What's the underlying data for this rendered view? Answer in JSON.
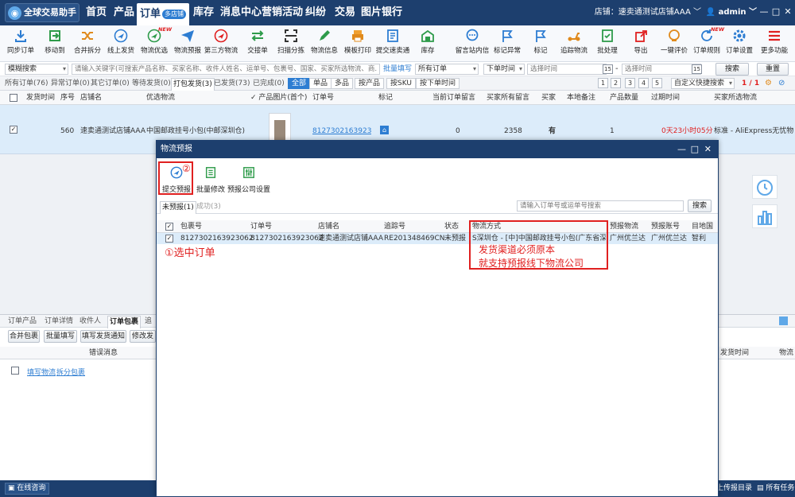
{
  "app": {
    "title": "全球交易助手"
  },
  "nav": [
    {
      "label": "首页"
    },
    {
      "label": "产品"
    },
    {
      "label": "订单",
      "badge": "多店铺"
    },
    {
      "label": "库存"
    },
    {
      "label": "消息中心"
    },
    {
      "label": "营销活动"
    },
    {
      "label": "纠纷"
    },
    {
      "label": "交易"
    },
    {
      "label": "图片银行"
    }
  ],
  "store": {
    "text": "店铺：速卖通测试店铺AAA"
  },
  "user": {
    "name": "admin"
  },
  "toolbar": [
    {
      "label": "同步订单",
      "icon": "download-icon"
    },
    {
      "label": "移动到",
      "icon": "move-icon"
    },
    {
      "label": "合并拆分",
      "icon": "shuffle-icon"
    },
    {
      "label": "线上发货",
      "icon": "plane-icon"
    },
    {
      "label": "物流优选",
      "icon": "plane-icon",
      "new": "NEW"
    },
    {
      "label": "物流预报",
      "icon": "paper-plane-icon"
    },
    {
      "label": "第三方物流",
      "icon": "third-party-icon"
    },
    {
      "label": "交接单",
      "icon": "exchange-icon"
    },
    {
      "label": "扫描分拣",
      "icon": "scan-icon"
    },
    {
      "label": "物流信息",
      "icon": "pencil-icon"
    },
    {
      "label": "模板打印",
      "icon": "printer-icon"
    },
    {
      "label": "提交速卖通",
      "icon": "document-icon"
    },
    {
      "label": "库存",
      "icon": "warehouse-icon"
    },
    {
      "label": "留言站内信",
      "icon": "message-icon"
    },
    {
      "label": "标记异常",
      "icon": "flag-icon"
    },
    {
      "label": "标记",
      "icon": "flag-icon"
    },
    {
      "label": "追踪物流",
      "icon": "scooter-icon"
    },
    {
      "label": "批处理",
      "icon": "checklist-icon"
    },
    {
      "label": "导出",
      "icon": "export-icon"
    },
    {
      "label": "一键评价",
      "icon": "review-icon"
    },
    {
      "label": "订单规则",
      "icon": "refresh-icon",
      "new": "NEW"
    },
    {
      "label": "订单设置",
      "icon": "gear-icon"
    },
    {
      "label": "更多功能",
      "icon": "menu-icon"
    }
  ],
  "filter": {
    "mode": "模糊搜索",
    "keyword_placeholder": "请输入关键字(可搜索产品名称、买家名称、收件人姓名、运单号、包裹号、国家、买家所选物流、商...",
    "batch_fill": "批量填写",
    "order_select": "所有订单",
    "time_type": "下单时间",
    "start_placeholder": "选择时间",
    "end_placeholder": "选择时间",
    "date_icon": "15",
    "search": "搜索",
    "reset": "重置"
  },
  "tabs": [
    {
      "label": "所有订单(76)"
    },
    {
      "label": "异常订单(0)"
    },
    {
      "label": "其它订单(0)"
    },
    {
      "label": "等待发货(0)"
    },
    {
      "label": "打包发货(3)"
    },
    {
      "label": "已发货(73)"
    },
    {
      "label": "已完成(0)"
    }
  ],
  "chips": [
    {
      "label": "全部"
    },
    {
      "label": "单品"
    },
    {
      "label": "多品"
    },
    {
      "label": "按产品"
    },
    {
      "label": "按SKU"
    },
    {
      "label": "按下单时间"
    }
  ],
  "pager": {
    "pages": [
      "1",
      "2",
      "3",
      "4",
      "5"
    ],
    "sort": "自定义快捷搜索",
    "count": "1 / 1"
  },
  "grid": {
    "headers": [
      "发货时间",
      "序号",
      "店铺名",
      "优选物流",
      "产品图片(首个)",
      "订单号",
      "标记",
      "当前订单留言",
      "买家所有留言",
      "买家",
      "本地备注",
      "产品数量",
      "过期时间",
      "买家所选物流"
    ],
    "row": {
      "seq": "560",
      "store": "速卖通测试店铺AAA",
      "logistics": "中国邮政挂号小包(中邮深圳仓)",
      "order": "8127302163923062",
      "cur_msg": "0",
      "all_msg": "2358",
      "buyer": "有",
      "qty": "1",
      "expire": "0天23小时05分",
      "buyer_logistics": "标准 - AliExpress无忧物流"
    }
  },
  "bottom": {
    "tabs": [
      "订单产品",
      "订单详情",
      "收件人",
      "订单包裹",
      "追"
    ],
    "buttons": [
      "合并包裹",
      "批量填写",
      "填写发货通知",
      "修改发货"
    ],
    "col_error": "错误消息",
    "col_ship": "发货时间",
    "col_log": "物流",
    "link_fill": "填写物流",
    "link_split": "拆分包裹"
  },
  "status": {
    "consult": "在线咨询",
    "report": "查看上传报目录",
    "tasks": "所有任务"
  },
  "dialog": {
    "title": "物流预报",
    "toolbar": [
      {
        "label": "提交预报",
        "icon": "paper-plane-icon"
      },
      {
        "label": "批量修改",
        "icon": "batch-edit-icon"
      },
      {
        "label": "预报公司设置",
        "icon": "settings-sliders-icon"
      }
    ],
    "marker2": "②",
    "tabs": [
      "未预报(1)",
      "成功(3)"
    ],
    "search_placeholder": "请输入订单号或运单号搜索",
    "search": "搜索",
    "headers": [
      "包裹号",
      "订单号",
      "店铺名",
      "追踪号",
      "状态",
      "物流方式",
      "预报物流",
      "预报账号",
      "目地国"
    ],
    "row": {
      "package": "8127302163923062",
      "order": "8127302163923062",
      "store": "速卖通测试店铺AAA",
      "tracking": "RE201348469CN",
      "status": "未预报",
      "method": "S深圳仓 - [中]中国邮政挂号小包(广东省深圳",
      "fc_logistics": "广州优兰达",
      "fc_account": "广州优兰达",
      "country": "智利"
    },
    "note1": "①选中订单",
    "note2a": "发货渠道必须原本",
    "note2b": "就支持预报线下物流公司"
  }
}
